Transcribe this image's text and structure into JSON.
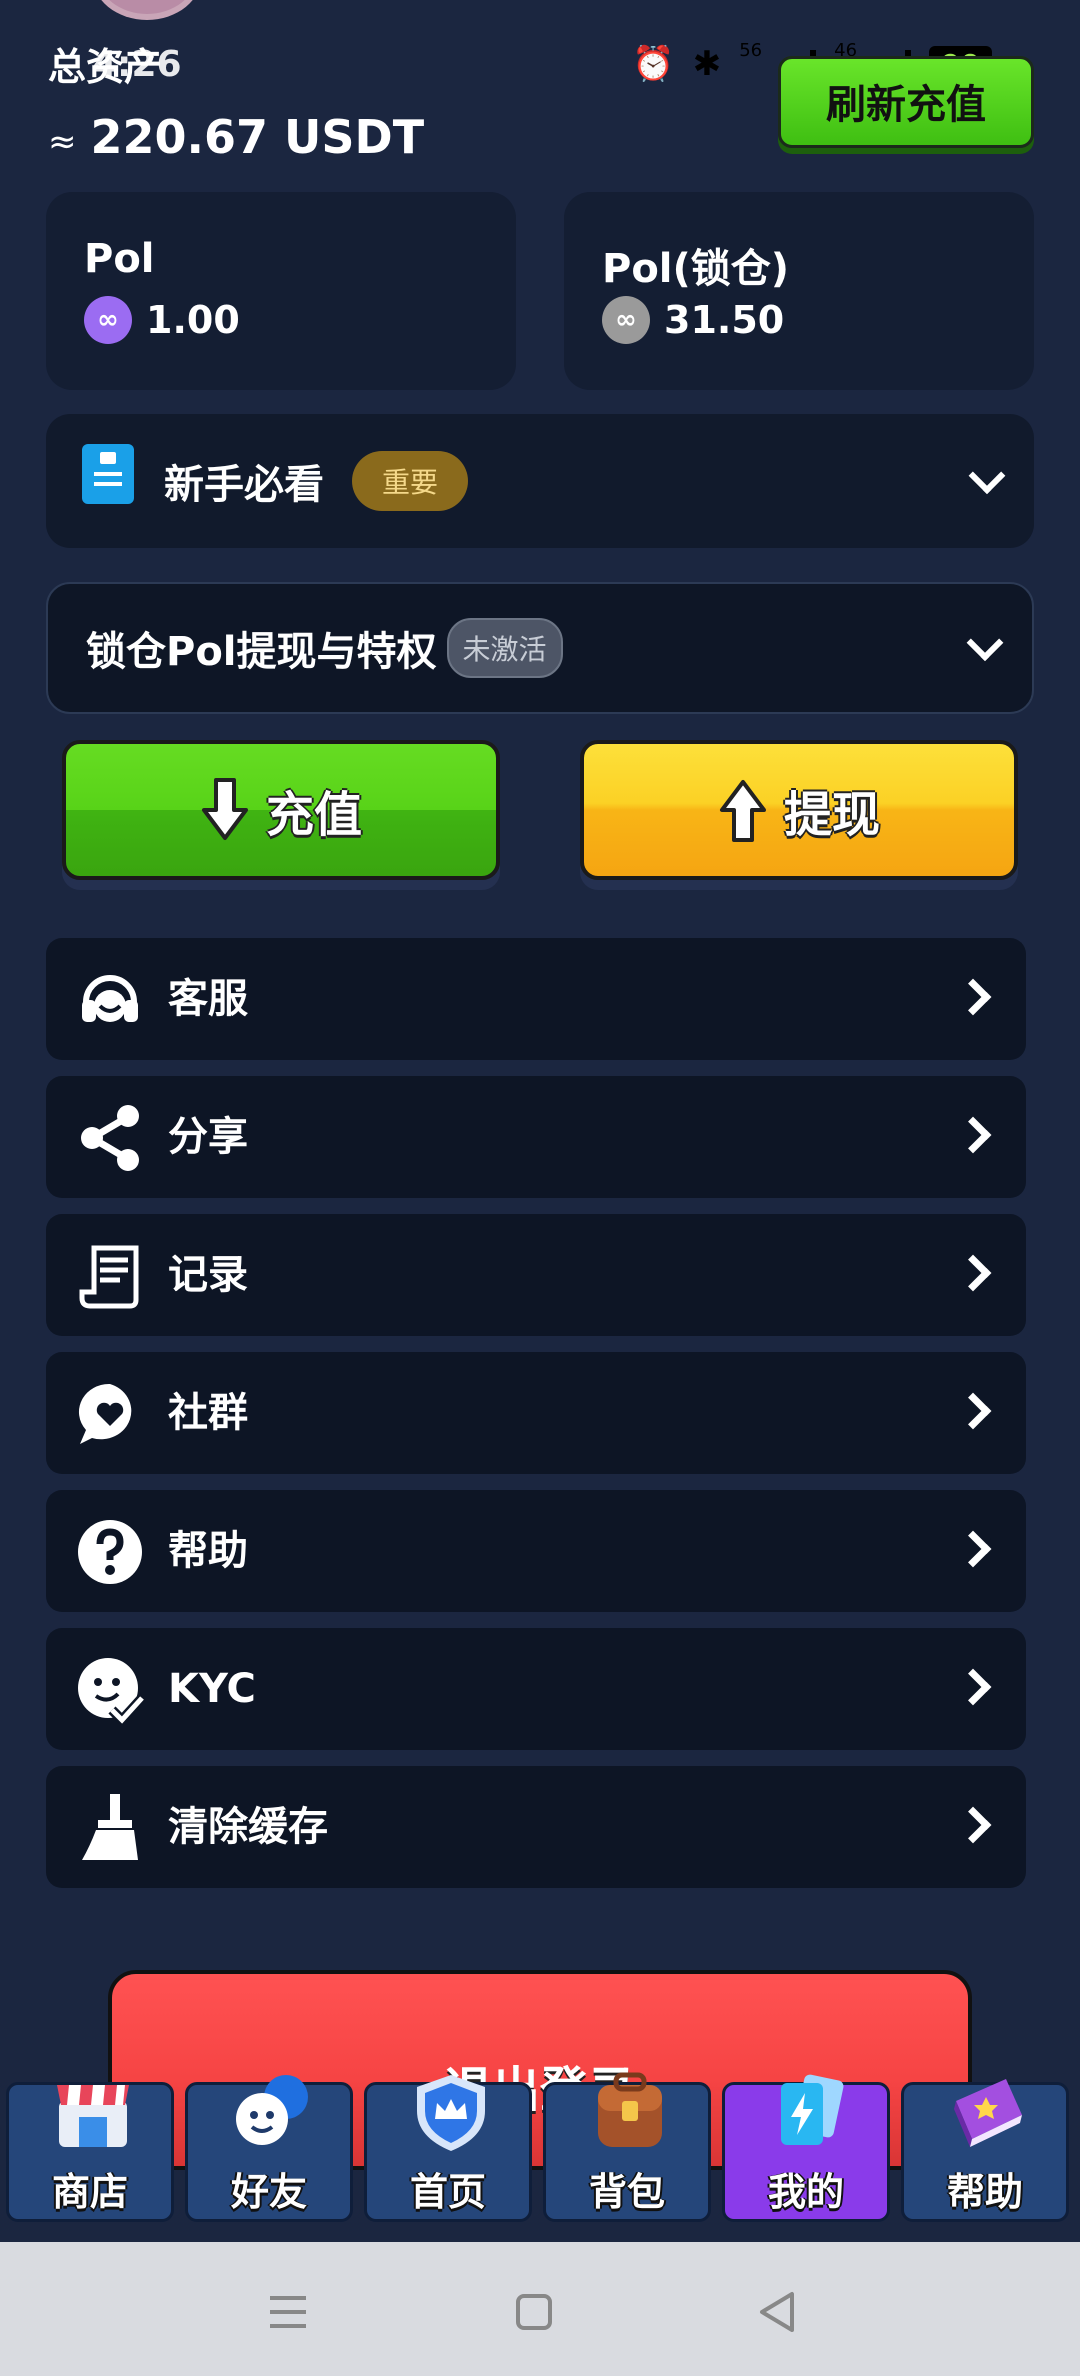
{
  "status_bar": {
    "time": "4:26",
    "network_a": "56",
    "network_b": "46",
    "battery": "90"
  },
  "header": {
    "total_label": "总资产",
    "approx": "≈",
    "total_value": "220.67 USDT",
    "refresh_label": "刷新充值"
  },
  "balances": [
    {
      "name": "Pol",
      "value": "1.00",
      "coin_color": "#9b6cf2"
    },
    {
      "name": "Pol(锁仓)",
      "value": "31.50",
      "coin_color": "#9a9a9a"
    }
  ],
  "newbie": {
    "title": "新手必看",
    "tag": "重要"
  },
  "locked": {
    "title": "锁仓Pol提现与特权",
    "tag": "未激活"
  },
  "actions": {
    "recharge": "充值",
    "withdraw": "提现"
  },
  "menu": [
    {
      "label": "客服",
      "icon": "headset-icon"
    },
    {
      "label": "分享",
      "icon": "share-icon"
    },
    {
      "label": "记录",
      "icon": "receipt-icon"
    },
    {
      "label": "社群",
      "icon": "chat-heart-icon"
    },
    {
      "label": "帮助",
      "icon": "question-icon"
    },
    {
      "label": "KYC",
      "icon": "face-check-icon"
    },
    {
      "label": "清除缓存",
      "icon": "broom-icon"
    }
  ],
  "logout": {
    "label": "退出登录"
  },
  "tabs": [
    {
      "label": "商店",
      "active": false
    },
    {
      "label": "好友",
      "active": false
    },
    {
      "label": "首页",
      "active": false
    },
    {
      "label": "背包",
      "active": false
    },
    {
      "label": "我的",
      "active": true
    },
    {
      "label": "帮助",
      "active": false
    }
  ],
  "colors": {
    "background": "#1b2640",
    "card": "#141e33",
    "green": "#58d318",
    "yellow": "#fbd125",
    "red": "#f64444",
    "tab_active": "#8a3bea",
    "tab": "#25467a"
  }
}
